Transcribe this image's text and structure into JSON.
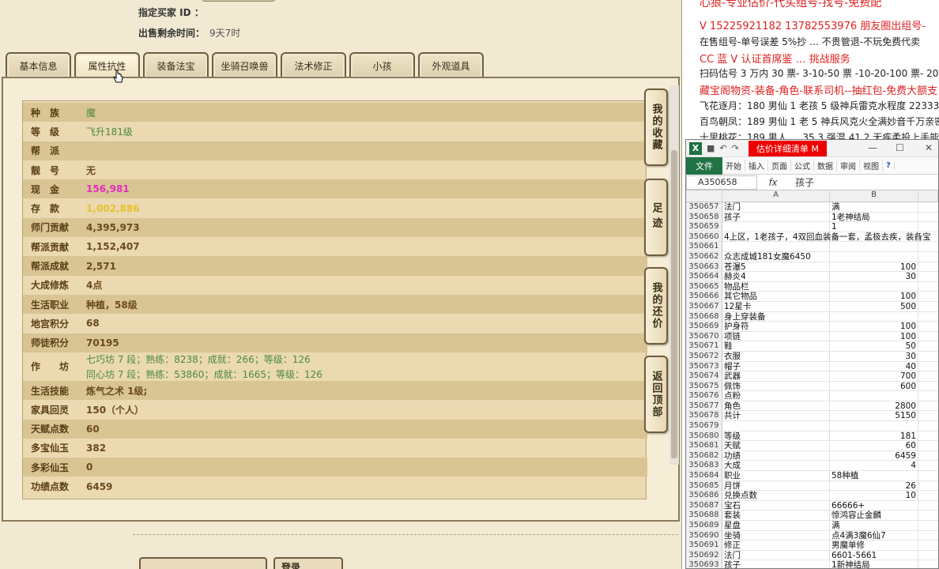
{
  "seller": {
    "buyer_label": "指定买家 ID ：",
    "buyer_value": "",
    "time_label": "出售剩余时间：",
    "time_value": "9天7时"
  },
  "tabs": [
    "基本信息",
    "属性抗性",
    "装备法宝",
    "坐骑召唤兽",
    "法术修正",
    "小孩",
    "外观道具"
  ],
  "active_tab": "属性抗性",
  "attributes": [
    {
      "k": "种　族",
      "v": "魔",
      "style": "green"
    },
    {
      "k": "等　级",
      "v": "飞升181级",
      "style": "green"
    },
    {
      "k": "帮　派",
      "v": "",
      "style": "brown"
    },
    {
      "k": "靓　号",
      "v": "无",
      "style": "brown"
    },
    {
      "k": "现　金",
      "v": "156,981",
      "style": "pink"
    },
    {
      "k": "存　款",
      "v": "1,002,886",
      "style": "gold"
    },
    {
      "k": "师门贡献",
      "v": "4,395,973",
      "style": "brown"
    },
    {
      "k": "帮派贡献",
      "v": "1,152,407",
      "style": "brown"
    },
    {
      "k": "帮派成就",
      "v": "2,571",
      "style": "brown"
    },
    {
      "k": "大成修炼",
      "v": "4点",
      "style": "brown"
    },
    {
      "k": "生活职业",
      "v": "种植，58级",
      "style": "brown"
    },
    {
      "k": "地宫积分",
      "v": "68",
      "style": "brown"
    },
    {
      "k": "师徒积分",
      "v": "70195",
      "style": "brown"
    }
  ],
  "workshop": {
    "k": "作　　坊",
    "lines": [
      "七巧坊 7 段；熟练：8238；成就：266；等级：126",
      "同心坊 7 段；熟练：53860；成就：1665；等级：126"
    ]
  },
  "attributes2": [
    {
      "k": "生活技能",
      "v": "炼气之术 1级;",
      "style": "brown"
    },
    {
      "k": "家具回灵",
      "v": "150（个人）",
      "style": "brown"
    },
    {
      "k": "天赋点数",
      "v": "60",
      "style": "brown"
    },
    {
      "k": "多宝仙玉",
      "v": "382",
      "style": "brown"
    },
    {
      "k": "多彩仙玉",
      "v": "0",
      "style": "brown"
    },
    {
      "k": "功绩点数",
      "v": "6459",
      "style": "brown"
    }
  ],
  "side_nav": [
    "我的收藏",
    "足迹",
    "我的还价",
    "返回顶部"
  ],
  "bottom_buttons": [
    "登录"
  ],
  "ads": {
    "line0": "心狼-专业估价-代买组号-找号-免费配",
    "line1": "V 15225921182   13782553976 朋友圈出组号-",
    "line2": "在售组号-单号误差 5%抄  …  不贵管退-不玩免费代卖",
    "line3": "CC 蓝 V 认证首席鉴    …    挑战服务",
    "line4": "扫码估号 3 万内 30 票- 3-10-50 票  -10-20-100 票- 20以上 150",
    "line5": "藏宝阁物资-装备-角色-联系司机--抽红包-免费大额支",
    "line6": "飞花逐月：180 男仙 1 老孩 5 级神兵雷克水程度 22333",
    "line7": "百鸟朝凤：189 男仙 1 老 5 神兵风克火全满妙音千万亲密 21",
    "line8": "十里桃花：189 男人 … 35 3 强混 41 2 无疾柔投上手能玩 2"
  },
  "excel": {
    "filename": "估价详细清单 M",
    "file_tab": "文件",
    "ribbon_tabs": [
      "开始",
      "插入",
      "页面",
      "公式",
      "数据",
      "审阅",
      "视图"
    ],
    "namebox": "A350658",
    "formula_value": "孩子",
    "col_headers": [
      "A",
      "B"
    ],
    "rows": [
      [
        "350657",
        "法门",
        "满",
        false
      ],
      [
        "350658",
        "孩子",
        "1老神结局",
        false
      ],
      [
        "350659",
        "",
        "1",
        false
      ],
      [
        "350660",
        "4上区，1老孩子，4双回血装备一套，孟极去疾，装备宝",
        "",
        false
      ],
      [
        "350661",
        "",
        "",
        false
      ],
      [
        "350662",
        "众志成城181女魔6450",
        "",
        false
      ],
      [
        "350663",
        "苍瀑5",
        "100",
        true
      ],
      [
        "350664",
        "赫炎4",
        "30",
        true
      ],
      [
        "350665",
        "物品栏",
        "",
        false
      ],
      [
        "350666",
        "其它物品",
        "100",
        true
      ],
      [
        "350667",
        "12星卡",
        "500",
        true
      ],
      [
        "350668",
        "身上穿装备",
        "",
        false
      ],
      [
        "350669",
        "护身符",
        "100",
        true
      ],
      [
        "350670",
        "项链",
        "100",
        true
      ],
      [
        "350671",
        "鞋",
        "50",
        true
      ],
      [
        "350672",
        "衣服",
        "30",
        true
      ],
      [
        "350673",
        "帽子",
        "40",
        true
      ],
      [
        "350674",
        "武器",
        "700",
        true
      ],
      [
        "350675",
        "佩饰",
        "600",
        true
      ],
      [
        "350676",
        "点粉",
        "",
        false
      ],
      [
        "350677",
        "角色",
        "2800",
        true
      ],
      [
        "350678",
        "共计",
        "5150",
        true
      ],
      [
        "350679",
        "",
        "",
        false
      ],
      [
        "350680",
        "等级",
        "181",
        true
      ],
      [
        "350681",
        "天赋",
        "60",
        true
      ],
      [
        "350682",
        "功绩",
        "6459",
        true
      ],
      [
        "350683",
        "大成",
        "4",
        true
      ],
      [
        "350684",
        "职业",
        "58种植",
        false
      ],
      [
        "350685",
        "月饼",
        "26",
        true
      ],
      [
        "350686",
        "兑换点数",
        "10",
        true
      ],
      [
        "350687",
        "宝石",
        "66666+",
        false
      ],
      [
        "350688",
        "套装",
        "惊鸿容止金麟",
        false
      ],
      [
        "350689",
        "星盘",
        "满",
        false
      ],
      [
        "350690",
        "坐骑",
        "点4满3魔6仙7",
        false
      ],
      [
        "350691",
        "修正",
        "男魔单修",
        false
      ],
      [
        "350692",
        "法门",
        "6601-5661",
        false
      ],
      [
        "350693",
        "孩子",
        "1新神结局",
        false
      ]
    ]
  }
}
